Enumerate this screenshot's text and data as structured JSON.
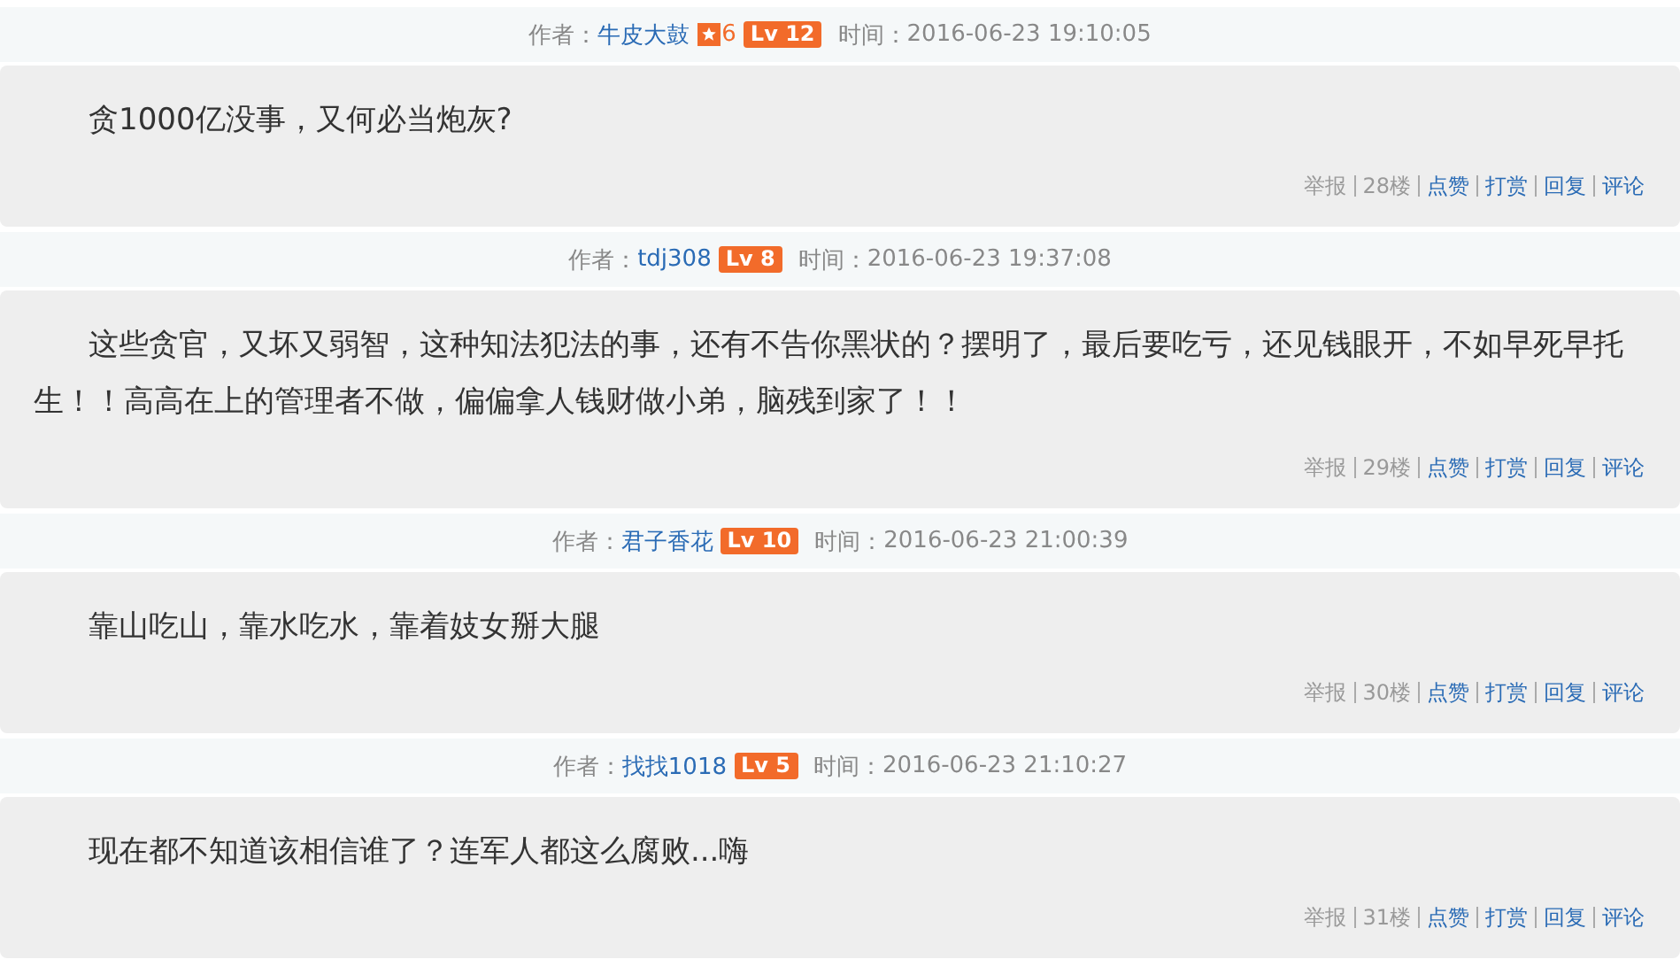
{
  "posts": [
    {
      "author_label": "作者：",
      "author": "牛皮大鼓",
      "medal": "6",
      "level": "Lv 12",
      "time_label": "时间：",
      "time": "2016-06-23 19:10:05",
      "text": "贪1000亿没事，又何必当炮灰?",
      "actions": [
        {
          "label": "举报",
          "kind": "plain"
        },
        {
          "label": "28楼",
          "kind": "plain"
        },
        {
          "label": "点赞",
          "kind": "link"
        },
        {
          "label": "打赏",
          "kind": "link"
        },
        {
          "label": "回复",
          "kind": "link"
        },
        {
          "label": "评论",
          "kind": "link"
        }
      ]
    },
    {
      "author_label": "作者：",
      "author": "tdj308",
      "level": "Lv 8",
      "time_label": "时间：",
      "time": "2016-06-23 19:37:08",
      "text": "这些贪官，又坏又弱智，这种知法犯法的事，还有不告你黑状的？摆明了，最后要吃亏，还见钱眼开，不如早死早托生！！高高在上的管理者不做，偏偏拿人钱财做小弟，脑残到家了！！",
      "actions": [
        {
          "label": "举报",
          "kind": "plain"
        },
        {
          "label": "29楼",
          "kind": "plain"
        },
        {
          "label": "点赞",
          "kind": "link"
        },
        {
          "label": "打赏",
          "kind": "link"
        },
        {
          "label": "回复",
          "kind": "link"
        },
        {
          "label": "评论",
          "kind": "link"
        }
      ]
    },
    {
      "author_label": "作者：",
      "author": "君子香花",
      "level": "Lv 10",
      "time_label": "时间：",
      "time": "2016-06-23 21:00:39",
      "text": "靠山吃山，靠水吃水，靠着妓女掰大腿",
      "actions": [
        {
          "label": "举报",
          "kind": "plain"
        },
        {
          "label": "30楼",
          "kind": "plain"
        },
        {
          "label": "点赞",
          "kind": "link"
        },
        {
          "label": "打赏",
          "kind": "link"
        },
        {
          "label": "回复",
          "kind": "link"
        },
        {
          "label": "评论",
          "kind": "link"
        }
      ]
    },
    {
      "author_label": "作者：",
      "author": "找找1018",
      "level": "Lv 5",
      "time_label": "时间：",
      "time": "2016-06-23 21:10:27",
      "text": "现在都不知道该相信谁了？连军人都这么腐败...嗨",
      "actions": [
        {
          "label": "举报",
          "kind": "plain"
        },
        {
          "label": "31楼",
          "kind": "plain"
        },
        {
          "label": "点赞",
          "kind": "link"
        },
        {
          "label": "打赏",
          "kind": "link"
        },
        {
          "label": "回复",
          "kind": "link"
        },
        {
          "label": "评论",
          "kind": "link"
        }
      ]
    }
  ]
}
